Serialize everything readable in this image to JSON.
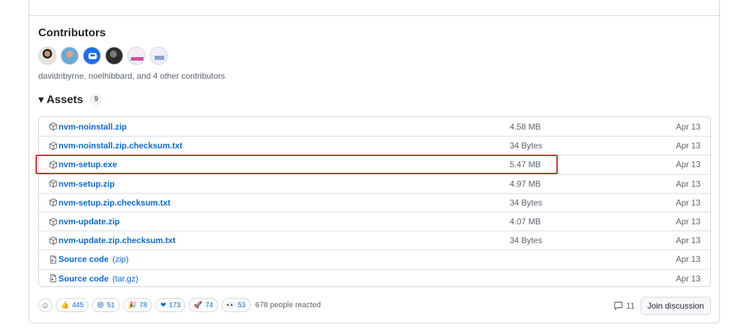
{
  "contributors": {
    "title": "Contributors",
    "avatars": [
      "davidribyrne",
      "noelhibbard",
      "bot",
      "contributor",
      "contributor",
      "contributor"
    ],
    "summary": "davidribyrne, noelhibbard, and 4 other contributors"
  },
  "assets": {
    "toggle": "▾",
    "title": "Assets",
    "count": "9",
    "rows": [
      {
        "name": "nvm-noinstall.zip",
        "suffix": "",
        "size": "4.58 MB",
        "date": "Apr 13",
        "icon": "package-icon"
      },
      {
        "name": "nvm-noinstall.zip.checksum.txt",
        "suffix": "",
        "size": "34 Bytes",
        "date": "Apr 13",
        "icon": "package-icon"
      },
      {
        "name": "nvm-setup.exe",
        "suffix": "",
        "size": "5.47 MB",
        "date": "Apr 13",
        "icon": "package-icon"
      },
      {
        "name": "nvm-setup.zip",
        "suffix": "",
        "size": "4.97 MB",
        "date": "Apr 13",
        "icon": "package-icon"
      },
      {
        "name": "nvm-setup.zip.checksum.txt",
        "suffix": "",
        "size": "34 Bytes",
        "date": "Apr 13",
        "icon": "package-icon"
      },
      {
        "name": "nvm-update.zip",
        "suffix": "",
        "size": "4.07 MB",
        "date": "Apr 13",
        "icon": "package-icon"
      },
      {
        "name": "nvm-update.zip.checksum.txt",
        "suffix": "",
        "size": "34 Bytes",
        "date": "Apr 13",
        "icon": "package-icon"
      },
      {
        "name": "Source code",
        "suffix": "(zip)",
        "size": "",
        "date": "Apr 13",
        "icon": "file-zip-icon"
      },
      {
        "name": "Source code",
        "suffix": "(tar.gz)",
        "size": "",
        "date": "Apr 13",
        "icon": "file-zip-icon"
      }
    ]
  },
  "reactions": {
    "items": [
      {
        "emoji": "👍",
        "count": "445",
        "name": "thumbs-up"
      },
      {
        "emoji": "😄",
        "count": "51",
        "name": "laugh"
      },
      {
        "emoji": "🎉",
        "count": "78",
        "name": "hooray"
      },
      {
        "emoji": "❤",
        "count": "173",
        "name": "heart"
      },
      {
        "emoji": "🚀",
        "count": "74",
        "name": "rocket"
      },
      {
        "emoji": "👀",
        "count": "53",
        "name": "eyes"
      }
    ],
    "summary": "678 people reacted"
  },
  "discussion": {
    "comment_count": "11",
    "join_label": "Join discussion"
  },
  "colors": {
    "link": "#0969da",
    "highlight": "#e02828"
  }
}
